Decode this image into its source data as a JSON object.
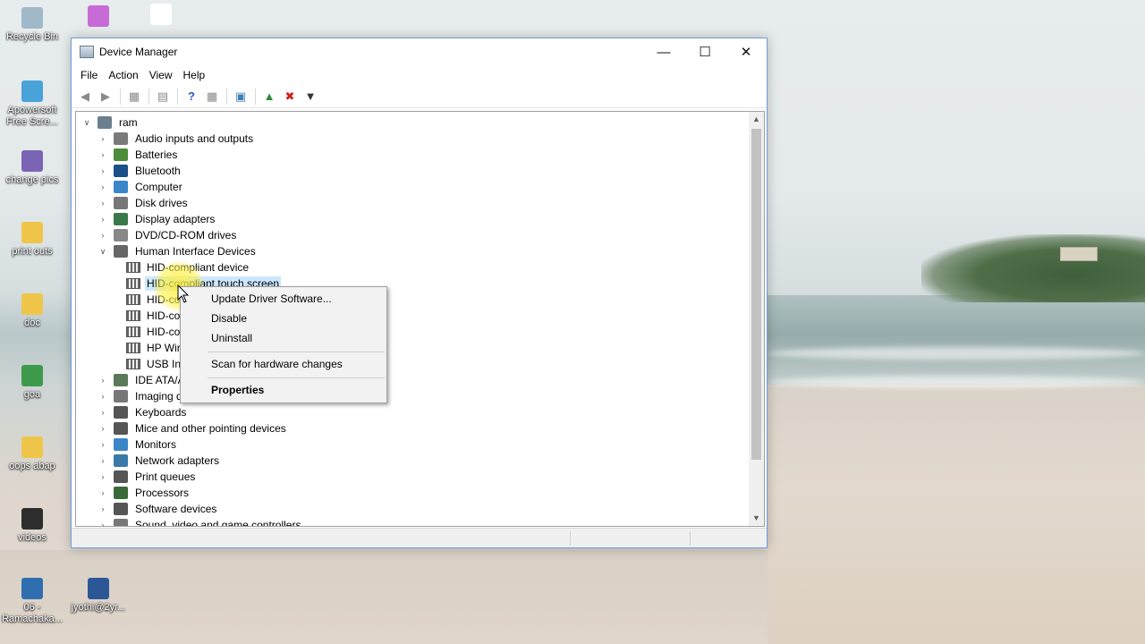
{
  "desktop": {
    "icons": [
      {
        "label": "Recycle Bin",
        "color": "#9fb9c9"
      },
      {
        "label": "",
        "color": "#c76bd6"
      },
      {
        "label": "",
        "color": "#ffffff"
      },
      {
        "label": "Apowersoft Free Scre...",
        "color": "#4aa3d8"
      },
      {
        "label": "change pics",
        "color": "#7a64b5"
      },
      {
        "label": "print outs",
        "color": "#f0c64a"
      },
      {
        "label": "doc",
        "color": "#f0c64a"
      },
      {
        "label": "goa",
        "color": "#3d9a4a"
      },
      {
        "label": "oops abap",
        "color": "#f0c64a"
      },
      {
        "label": "videos",
        "color": "#2d2d2d"
      },
      {
        "label": "06 - Ramachaka...",
        "color": "#2f6fb0"
      },
      {
        "label": "jyothi@2yr...",
        "color": "#2b5797"
      }
    ]
  },
  "window": {
    "title": "Device Manager",
    "controls": {
      "minimize": "—",
      "maximize": "☐",
      "close": "✕"
    }
  },
  "menu": [
    "File",
    "Action",
    "View",
    "Help"
  ],
  "tree": {
    "root": "ram",
    "categories": [
      {
        "label": "Audio inputs and outputs",
        "color": "#7a7a7a"
      },
      {
        "label": "Batteries",
        "color": "#4c8c3a"
      },
      {
        "label": "Bluetooth",
        "color": "#1b4f8a"
      },
      {
        "label": "Computer",
        "color": "#3a86c8"
      },
      {
        "label": "Disk drives",
        "color": "#777777"
      },
      {
        "label": "Display adapters",
        "color": "#3a7a4a"
      },
      {
        "label": "DVD/CD-ROM drives",
        "color": "#888888"
      },
      {
        "label": "Human Interface Devices",
        "color": "#666666"
      }
    ],
    "hid_children": [
      "HID-compliant device",
      "HID-compliant touch screen",
      "HID-com",
      "HID-co",
      "HID-co",
      "HP Wire",
      "USB Inp"
    ],
    "categories_after": [
      {
        "label": "IDE ATA/AT",
        "color": "#5a7a5a"
      },
      {
        "label": "Imaging de",
        "color": "#777777"
      },
      {
        "label": "Keyboards",
        "color": "#555555"
      },
      {
        "label": "Mice and other pointing devices",
        "color": "#555555"
      },
      {
        "label": "Monitors",
        "color": "#3a86c8"
      },
      {
        "label": "Network adapters",
        "color": "#3a7aa8"
      },
      {
        "label": "Print queues",
        "color": "#555555"
      },
      {
        "label": "Processors",
        "color": "#3a6a3a"
      },
      {
        "label": "Software devices",
        "color": "#555555"
      },
      {
        "label": "Sound, video and game controllers",
        "color": "#777777"
      }
    ]
  },
  "context_menu": {
    "update": "Update Driver Software...",
    "disable": "Disable",
    "uninstall": "Uninstall",
    "scan": "Scan for hardware changes",
    "properties": "Properties"
  }
}
